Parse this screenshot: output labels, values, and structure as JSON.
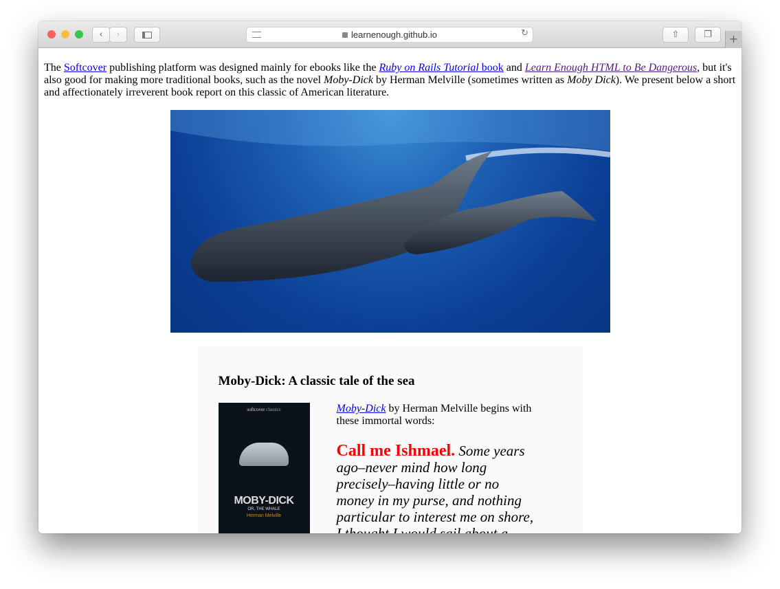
{
  "browser": {
    "url": "learnenough.github.io",
    "new_tab": "+"
  },
  "intro": {
    "t1": "The ",
    "softcover": "Softcover",
    "t2": " publishing platform was designed mainly for ebooks like the ",
    "rails": "Ruby on Rails Tutorial",
    "book": " book",
    "t3": " and ",
    "html": "Learn Enough HTML to Be Dangerous",
    "t4": ", but it's also good for making more traditional books, such as the novel ",
    "moby1": "Moby-Dick",
    "t5": " by Herman Melville (sometimes written as ",
    "moby2": "Moby Dick",
    "t6": "). We present below a short and affectionately irreverent book report on this classic of American literature."
  },
  "report": {
    "title": "Moby-Dick: A classic tale of the sea",
    "cover": {
      "publisher": "softcover",
      "series": "classics",
      "title": "MOBY-DICK",
      "subtitle": "OR, THE WHALE",
      "author": "Herman Melville"
    },
    "lead_link": "Moby-Dick",
    "lead_text": " by Herman Melville begins with these immortal words:",
    "call": "Call me Ishmael.",
    "quote": " Some years ago–never mind how long precisely–having little or no money in my purse, and nothing particular to interest me on shore, I thought I would sail about a little and see the"
  }
}
